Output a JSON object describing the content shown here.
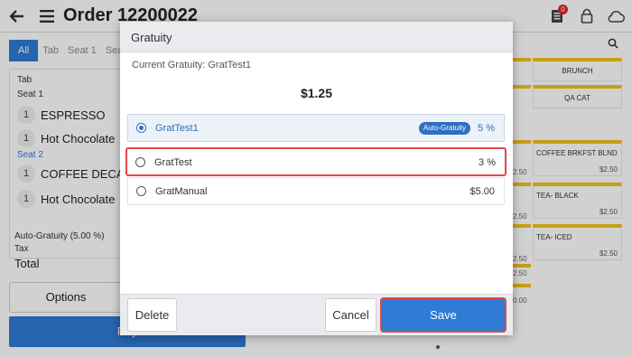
{
  "header": {
    "title": "Order 12200022",
    "receipt_badge": "0",
    "icons": [
      "back-arrow-icon",
      "hamburger-menu-icon",
      "receipt-icon",
      "lock-icon",
      "cloud-icon"
    ]
  },
  "left_panel": {
    "tabs": [
      "All",
      "Tab",
      "Seat 1",
      "Seat"
    ],
    "groups": {
      "tab_label": "Tab",
      "seat1_label": "Seat 1",
      "seat2_label": "Seat 2"
    },
    "items": [
      {
        "qty": "1",
        "name": "ESPRESSO"
      },
      {
        "qty": "1",
        "name": "Hot Chocolate"
      },
      {
        "qty": "1",
        "name": "COFFEE DECAF"
      },
      {
        "qty": "1",
        "name": "Hot Chocolate"
      }
    ],
    "totals": {
      "auto_gratuity": "Auto-Gratuity (5.00 %)",
      "tax": "Tax",
      "total": "Total"
    },
    "options_label": "Options",
    "pay_label": "Pay"
  },
  "menu_tiles": {
    "tiles": [
      {
        "name": "BRUNCH",
        "price": ""
      },
      {
        "name": "QA CAT",
        "price": ""
      },
      {
        "name": "COFFEE BRKFST BLND",
        "price": "$2.50"
      },
      {
        "name": "TEA- BLACK",
        "price": "$2.50"
      },
      {
        "name": "TEA- ICED",
        "price": "$2.50"
      }
    ],
    "edge_prices": [
      "2.50",
      "2.50",
      "2.50",
      "2.50",
      "0.00"
    ]
  },
  "dialog": {
    "title": "Gratuity",
    "current_label": "Current Gratuity: GratTest1",
    "amount": "$1.25",
    "options": [
      {
        "name": "GratTest1",
        "badge": "Auto-Gratuity",
        "value": "5 %",
        "selected": true
      },
      {
        "name": "GratTest",
        "badge": "",
        "value": "3 %",
        "selected": false
      },
      {
        "name": "GratManual",
        "badge": "",
        "value": "$5.00",
        "selected": false
      }
    ],
    "delete_label": "Delete",
    "cancel_label": "Cancel",
    "save_label": "Save"
  },
  "colors": {
    "accent": "#2f7bd6",
    "highlight": "#e04848",
    "tile_bar": "#f2c318"
  }
}
